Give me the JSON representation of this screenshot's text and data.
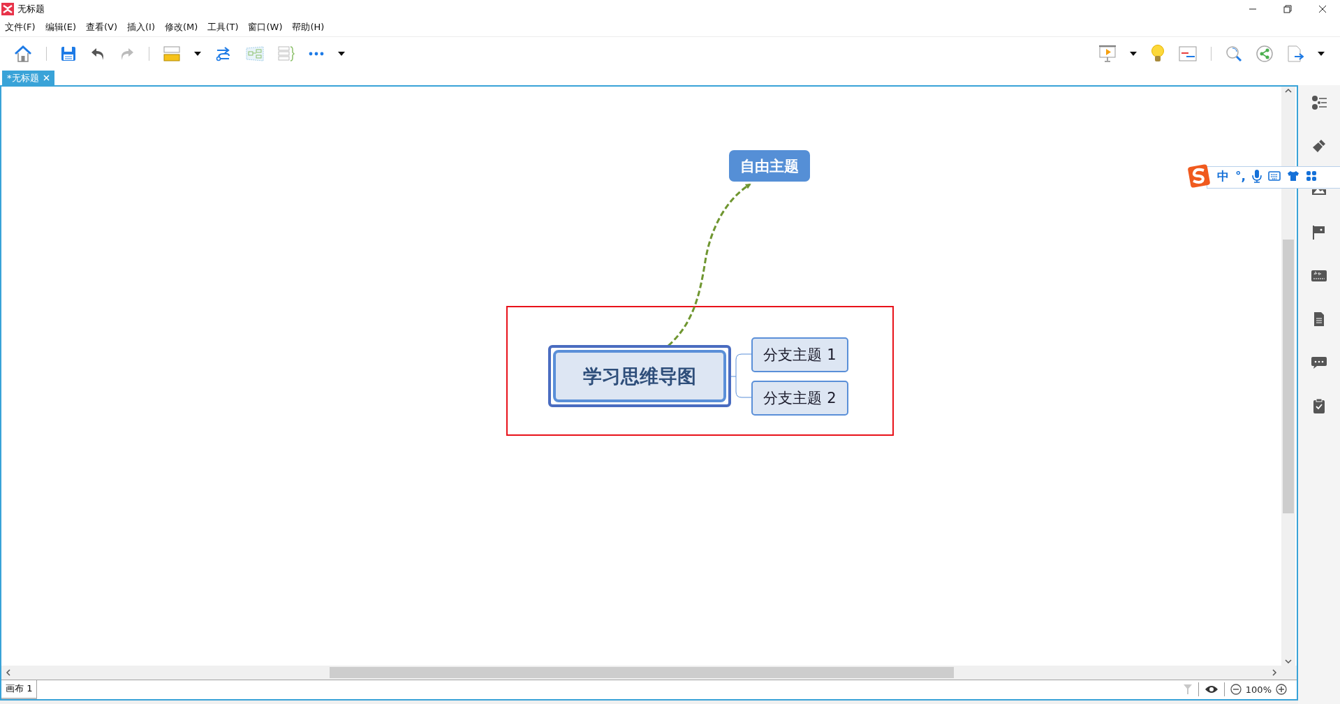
{
  "window": {
    "title": "无标题"
  },
  "menu": [
    {
      "label": "文件(F)"
    },
    {
      "label": "编辑(E)"
    },
    {
      "label": "查看(V)"
    },
    {
      "label": "插入(I)"
    },
    {
      "label": "修改(M)"
    },
    {
      "label": "工具(T)"
    },
    {
      "label": "窗口(W)"
    },
    {
      "label": "帮助(H)"
    }
  ],
  "tabs": [
    {
      "label": "*无标题",
      "selected": true
    }
  ],
  "canvas": {
    "central_topic": "学习思维导图",
    "subtopics": [
      {
        "label": "分支主题 1"
      },
      {
        "label": "分支主题 2"
      }
    ],
    "free_topic": "自由主题"
  },
  "ime_toolbar": {
    "mode": "中",
    "punctuation": "°,"
  },
  "status_bar": {
    "sheets": [
      {
        "label": "画布 1",
        "selected": true
      }
    ],
    "zoom": "100%"
  }
}
